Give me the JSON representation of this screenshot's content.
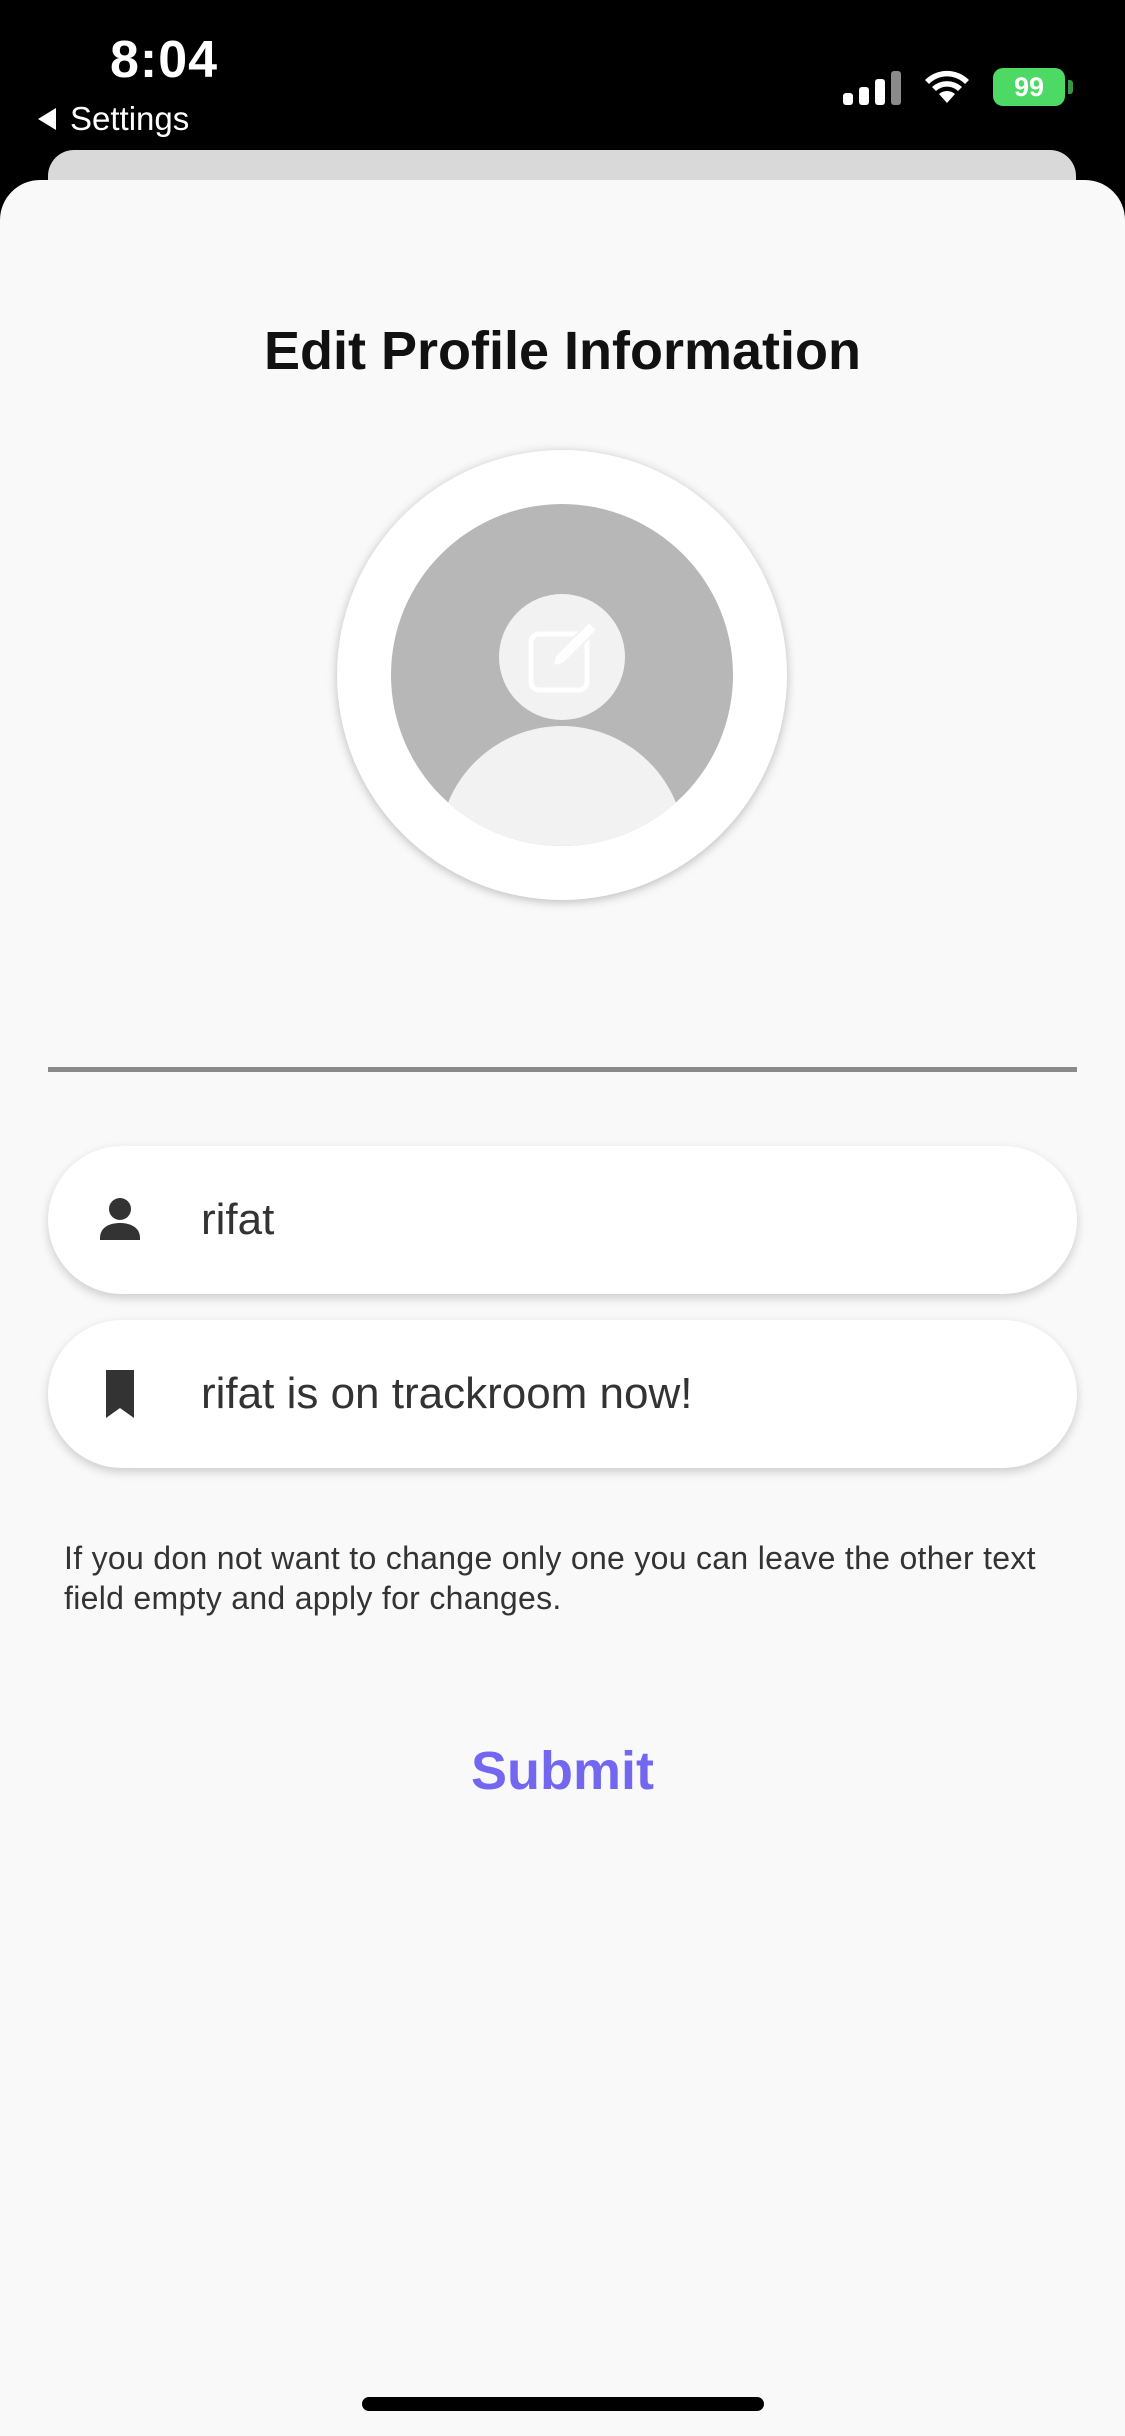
{
  "status_bar": {
    "time": "8:04",
    "back_label": "Settings",
    "battery_level": "99"
  },
  "page": {
    "title": "Edit Profile Information"
  },
  "form": {
    "name_field": {
      "value": "rifat",
      "icon": "person-icon"
    },
    "status_field": {
      "value": "rifat is on trackroom now!",
      "icon": "bookmark-icon"
    },
    "hint": "If you don not want to change only one you can leave the other text field empty and apply for changes.",
    "submit_label": "Submit"
  },
  "colors": {
    "accent": "#7367f0",
    "battery": "#4cd964",
    "sheet_background": "#f9f9f9"
  }
}
